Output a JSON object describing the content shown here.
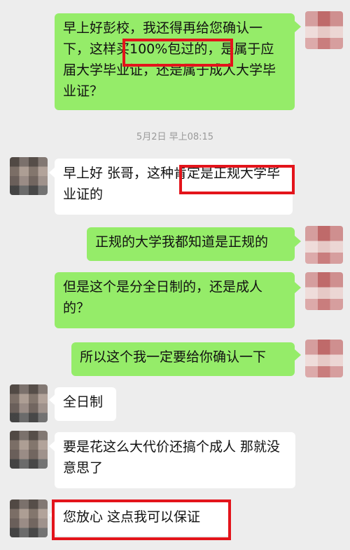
{
  "timestamp": "5月2日 早上08:15",
  "messages": [
    {
      "side": "me",
      "text": "早上好彭校，我还得再给您确认一下，这样买100%包过的，是属于应届大学毕业证，还是属于成人大学毕业证？"
    },
    {
      "side": "peer",
      "text": "早上好 张哥，这种肯定是正规大学毕业证的"
    },
    {
      "side": "me",
      "text": "正规的大学我都知道是正规的"
    },
    {
      "side": "me",
      "text": "但是这个是分全日制的，还是成人的？"
    },
    {
      "side": "me",
      "text": "所以这个我一定要给你确认一下"
    },
    {
      "side": "peer",
      "text": "全日制"
    },
    {
      "side": "peer",
      "text": "要是花这么大代价还搞个成人 那就没意思了"
    },
    {
      "side": "peer",
      "text": "您放心 这点我可以保证"
    }
  ],
  "colors": {
    "background": "#ededed",
    "sent_bubble": "#95ec69",
    "received_bubble": "#ffffff",
    "highlight_box": "#e3141b"
  }
}
